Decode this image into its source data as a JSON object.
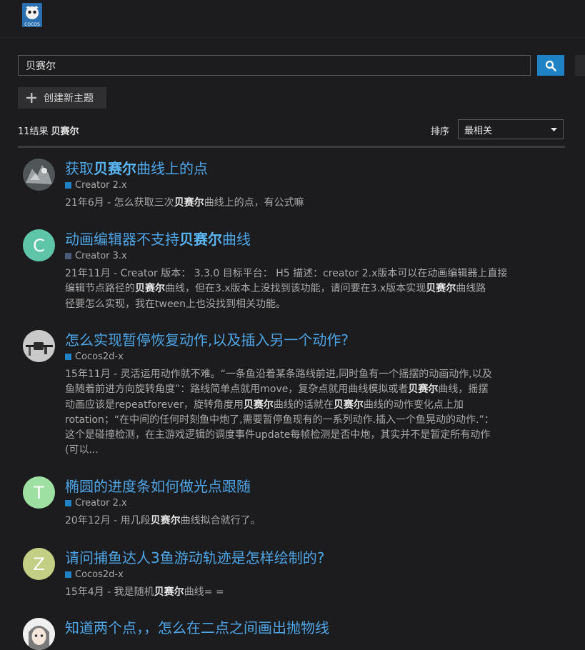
{
  "header": {
    "logo_text": "COCOS"
  },
  "search": {
    "value": "贝赛尔",
    "button_icon": "search-icon"
  },
  "create_topic": {
    "label": "创建新主题",
    "icon": "plus-icon"
  },
  "results": {
    "count_text": "11结果",
    "term": "贝赛尔"
  },
  "sort": {
    "label": "排序",
    "selected": "最相关"
  },
  "colors": {
    "link": "#4ea5e6",
    "accent": "#1f82c4",
    "background": "#1c1c1e"
  },
  "topics": [
    {
      "title": [
        {
          "t": "获取"
        },
        {
          "t": "贝赛尔",
          "b": true
        },
        {
          "t": "曲线上的点"
        }
      ],
      "category": "Creator 2.x",
      "category_color": "#1f82c4",
      "blurb": [
        {
          "t": "21年6月 - 怎么获取三次"
        },
        {
          "t": "贝赛尔",
          "b": true
        },
        {
          "t": "曲线上的点，有公式嘛"
        }
      ],
      "avatar_type": "image",
      "avatar_letter": ""
    },
    {
      "title": [
        {
          "t": "动画编辑器不支持"
        },
        {
          "t": "贝赛尔",
          "b": true
        },
        {
          "t": "曲线"
        }
      ],
      "category": "Creator 3.x",
      "category_color": "#4d5a7a",
      "blurb": [
        {
          "t": "21年11月 - Creator 版本： 3.3.0 目标平台： H5 描述：creator 2.x版本可以在动画编辑器上直接"
        },
        {
          "br": true
        },
        {
          "t": "编辑节点路径的"
        },
        {
          "t": "贝赛尔",
          "b": true
        },
        {
          "t": "曲线，但在3.x版本上没找到该功能，请问要在3.x版本实现"
        },
        {
          "t": "贝赛尔",
          "b": true
        },
        {
          "t": "曲线路"
        },
        {
          "br": true
        },
        {
          "t": "径要怎么实现，我在tween上也没找到相关功能。"
        }
      ],
      "avatar_type": "letter",
      "avatar_letter": "C",
      "avatar_color": "#5fc5a8"
    },
    {
      "title": [
        {
          "t": "怎么实现暂停恢复动作,以及插入另一个动作?"
        }
      ],
      "category": "Cocos2d-x",
      "category_color": "#1f82c4",
      "blurb": [
        {
          "t": "15年11月 - 灵活运用动作就不难。“一条鱼沿着某条路线前进,同时鱼有一个摇摆的动画动作,以及"
        },
        {
          "br": true
        },
        {
          "t": "鱼随着前进方向旋转角度”：路线简单点就用move，复杂点就用曲线模拟或者"
        },
        {
          "t": "贝赛尔",
          "b": true
        },
        {
          "t": "曲线，摇摆"
        },
        {
          "br": true
        },
        {
          "t": "动画应该是repeatforever，旋转角度用"
        },
        {
          "t": "贝赛尔",
          "b": true
        },
        {
          "t": "曲线的话就在"
        },
        {
          "t": "贝赛尔",
          "b": true
        },
        {
          "t": "曲线的动作变化点上加"
        },
        {
          "br": true
        },
        {
          "t": "rotation；“在中间的任何时刻鱼中炮了,需要暂停鱼现有的一系列动作.插入一个鱼晃动的动作.”："
        },
        {
          "br": true
        },
        {
          "t": "这个是碰撞检测，在主游戏逻辑的调度事件update每帧检测是否中炮，其实并不是暂定所有动作"
        },
        {
          "br": true
        },
        {
          "t": "(可以..."
        }
      ],
      "avatar_type": "image",
      "avatar_letter": ""
    },
    {
      "title": [
        {
          "t": "椭圆的进度条如何做光点跟随"
        }
      ],
      "category": "Creator 2.x",
      "category_color": "#1f82c4",
      "blurb": [
        {
          "t": "20年12月 - 用几段"
        },
        {
          "t": "贝赛尔",
          "b": true
        },
        {
          "t": "曲线拟合就行了。"
        }
      ],
      "avatar_type": "letter",
      "avatar_letter": "T",
      "avatar_color": "#9ee0a2"
    },
    {
      "title": [
        {
          "t": "请问捕鱼达人3鱼游动轨迹是怎样绘制的?"
        }
      ],
      "category": "Cocos2d-x",
      "category_color": "#1f82c4",
      "blurb": [
        {
          "t": "15年4月 - 我是随机"
        },
        {
          "t": "贝赛尔",
          "b": true
        },
        {
          "t": "曲线= ="
        }
      ],
      "avatar_type": "letter",
      "avatar_letter": "Z",
      "avatar_color": "#c3cf84"
    },
    {
      "title": [
        {
          "t": "知道两个点，，怎么在二点之间画出抛物线"
        }
      ],
      "category": "",
      "category_color": "#1f82c4",
      "blurb": [],
      "avatar_type": "image",
      "avatar_letter": ""
    }
  ]
}
